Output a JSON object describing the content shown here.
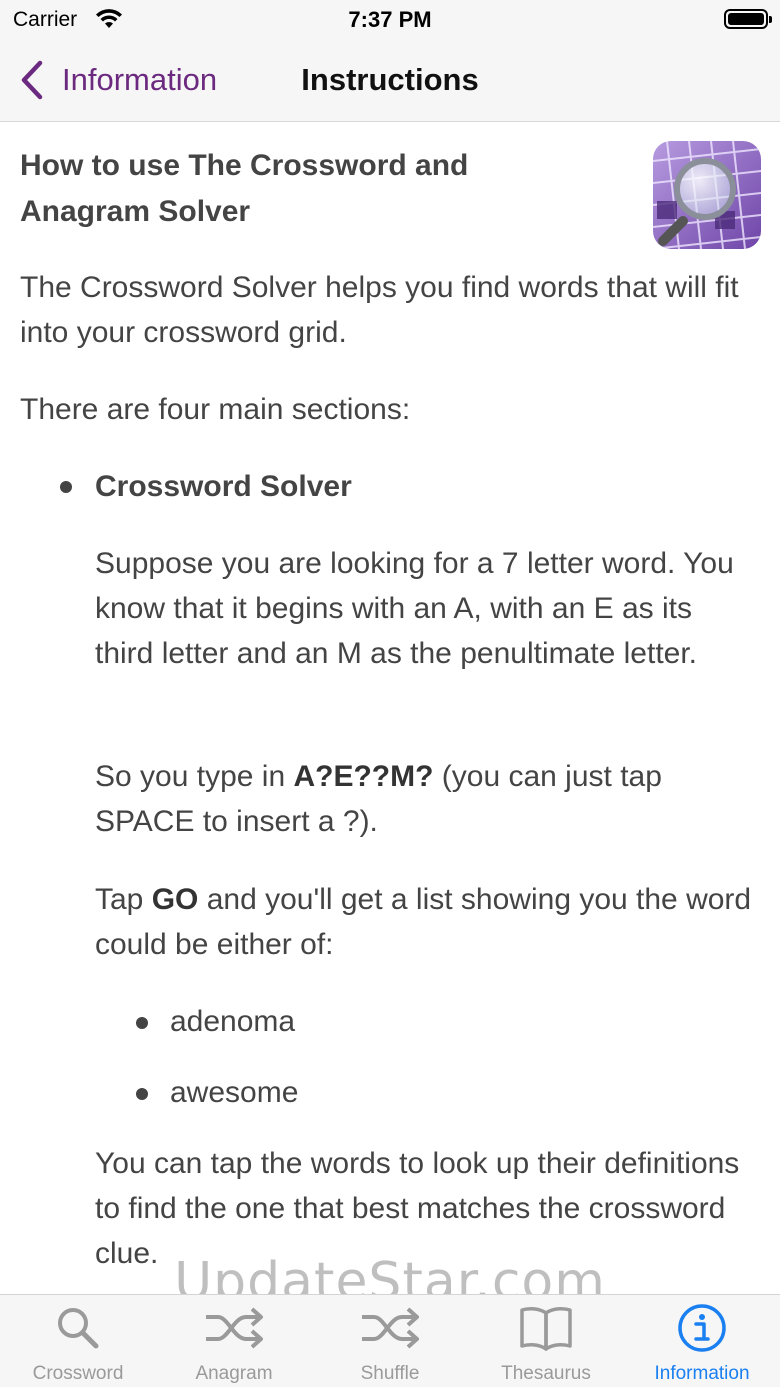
{
  "status": {
    "carrier": "Carrier",
    "time": "7:37 PM"
  },
  "nav": {
    "back_label": "Information",
    "title": "Instructions"
  },
  "content": {
    "heading_line1": "How to use The Crossword and",
    "heading_line2": "Anagram Solver",
    "intro": "The Crossword Solver helps you find words that will fit into your crossword grid.",
    "sections_intro": "There are four main sections:",
    "section_title": "Crossword Solver",
    "p1": "Suppose you are looking for a 7 letter word. You know that it begins with an A, with an E as its third letter and an M as the penultimate letter.",
    "p2_pre": "So you type in ",
    "p2_bold": "A?E??M?",
    "p2_post": " (you can just tap SPACE to insert a ?).",
    "p3_pre": "Tap ",
    "p3_bold": "GO",
    "p3_post": " and you'll get a list showing you the word could be either of:",
    "results": [
      "adenoma",
      "awesome"
    ],
    "p4": "You can tap the words to look up their definitions to find the one that best matches the crossword clue."
  },
  "watermark": "UpdateStar.com",
  "tabs": [
    {
      "label": "Crossword",
      "icon": "search-icon"
    },
    {
      "label": "Anagram",
      "icon": "shuffle-icon"
    },
    {
      "label": "Shuffle",
      "icon": "shuffle-icon"
    },
    {
      "label": "Thesaurus",
      "icon": "book-icon"
    },
    {
      "label": "Information",
      "icon": "info-icon"
    }
  ],
  "colors": {
    "accent": "#6b2a7f",
    "tab_active": "#1a7ff0",
    "tab_inactive": "#9a9a9a",
    "text": "#444444"
  }
}
